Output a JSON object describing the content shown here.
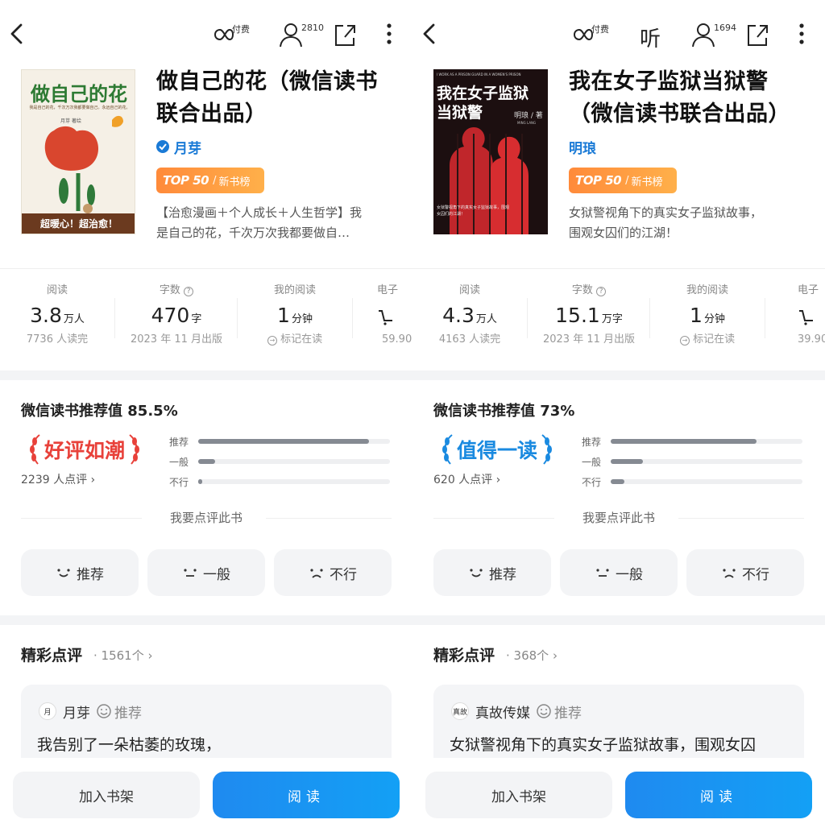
{
  "panels": [
    {
      "topbar": {
        "paid_label": "付费",
        "listen_label": "",
        "reader_count": "2810"
      },
      "book": {
        "title": "做自己的花（微信读书联合出品）",
        "title_line1": "做自己的花（微信读书",
        "title_line2": "联合出品）",
        "author": "月芽",
        "author_verified": true,
        "badge_top": "TOP 50",
        "badge_label": "新书榜",
        "blurb_line1": "【治愈漫画＋个人成长＋人生哲学】我",
        "blurb_line2": "是自己的花，千次万次我都要做自…",
        "cover": {
          "title": "做自己的花",
          "subtitle": "我是自己的花，千次万次我都要做自己。永远自己的花。",
          "author": "月芽",
          "author_suffix": "著绘",
          "footer": "超暖心！超治愈！"
        }
      },
      "stats": {
        "reads_label": "阅读",
        "reads_value": "3.8",
        "reads_unit": "万人",
        "reads_sub": "7736 人读完",
        "words_label": "字数",
        "words_value": "470",
        "words_unit": "字",
        "words_sub": "2023 年 11 月出版",
        "my_label": "我的阅读",
        "my_value": "1",
        "my_unit": "分钟",
        "my_sub": "标记在读",
        "ebook_label": "电子",
        "ebook_sub": "59.90"
      },
      "rating": {
        "title": "微信读书推荐值",
        "percent": "85.5%",
        "tag": "好评如潮",
        "tag_color": "#e8413a",
        "count": "2239 人点评",
        "bars": [
          {
            "label": "推荐",
            "value": 0.89
          },
          {
            "label": "一般",
            "value": 0.09
          },
          {
            "label": "不行",
            "value": 0.02
          }
        ],
        "comment_prompt": "我要点评此书",
        "vote_recommend": "推荐",
        "vote_ok": "一般",
        "vote_bad": "不行"
      },
      "reviews": {
        "title": "精彩点评",
        "count": "· 1561个",
        "reviewer": "月芽",
        "reviewer_avatar": "月",
        "review_tag": "推荐",
        "text": "我告别了一朵枯萎的玫瑰，"
      },
      "bottom": {
        "shelf": "加入书架",
        "read": "阅读"
      }
    },
    {
      "topbar": {
        "paid_label": "付费",
        "listen_label": "听",
        "reader_count": "1694"
      },
      "book": {
        "title": "我在女子监狱当狱警（微信读书联合出品）",
        "title_line1": "我在女子监狱当狱警",
        "title_line2": "（微信读书联合出品）",
        "author": "明琅",
        "author_verified": false,
        "badge_top": "TOP 50",
        "badge_label": "新书榜",
        "blurb_line1": "女狱警视角下的真实女子监狱故事，",
        "blurb_line2": "围观女囚们的江湖！",
        "cover": {
          "top_text": "I WORK AS A PRISON GUARD IN A WOMEN'S PRISON",
          "title_line1": "我在女子监狱",
          "title_line2": "当狱警",
          "author": "明琅 / 著",
          "author_en": "MING LANG",
          "caption": "女狱警视角下的真实女子监狱故事，围观女囚们的江湖！"
        }
      },
      "stats": {
        "reads_label": "阅读",
        "reads_value": "4.3",
        "reads_unit": "万人",
        "reads_sub": "4163 人读完",
        "words_label": "字数",
        "words_value": "15.1",
        "words_unit": "万字",
        "words_sub": "2023 年 11 月出版",
        "my_label": "我的阅读",
        "my_value": "1",
        "my_unit": "分钟",
        "my_sub": "标记在读",
        "ebook_label": "电子",
        "ebook_sub": "39.90"
      },
      "rating": {
        "title": "微信读书推荐值",
        "percent": "73%",
        "tag": "值得一读",
        "tag_color": "#1a8ae0",
        "count": "620 人点评",
        "bars": [
          {
            "label": "推荐",
            "value": 0.76
          },
          {
            "label": "一般",
            "value": 0.17
          },
          {
            "label": "不行",
            "value": 0.07
          }
        ],
        "comment_prompt": "我要点评此书",
        "vote_recommend": "推荐",
        "vote_ok": "一般",
        "vote_bad": "不行"
      },
      "reviews": {
        "title": "精彩点评",
        "count": "· 368个",
        "reviewer": "真故传媒",
        "reviewer_avatar": "真故",
        "review_tag": "推荐",
        "text": "女狱警视角下的真实女子监狱故事，围观女囚"
      },
      "bottom": {
        "shelf": "加入书架",
        "read": "阅读"
      }
    }
  ]
}
